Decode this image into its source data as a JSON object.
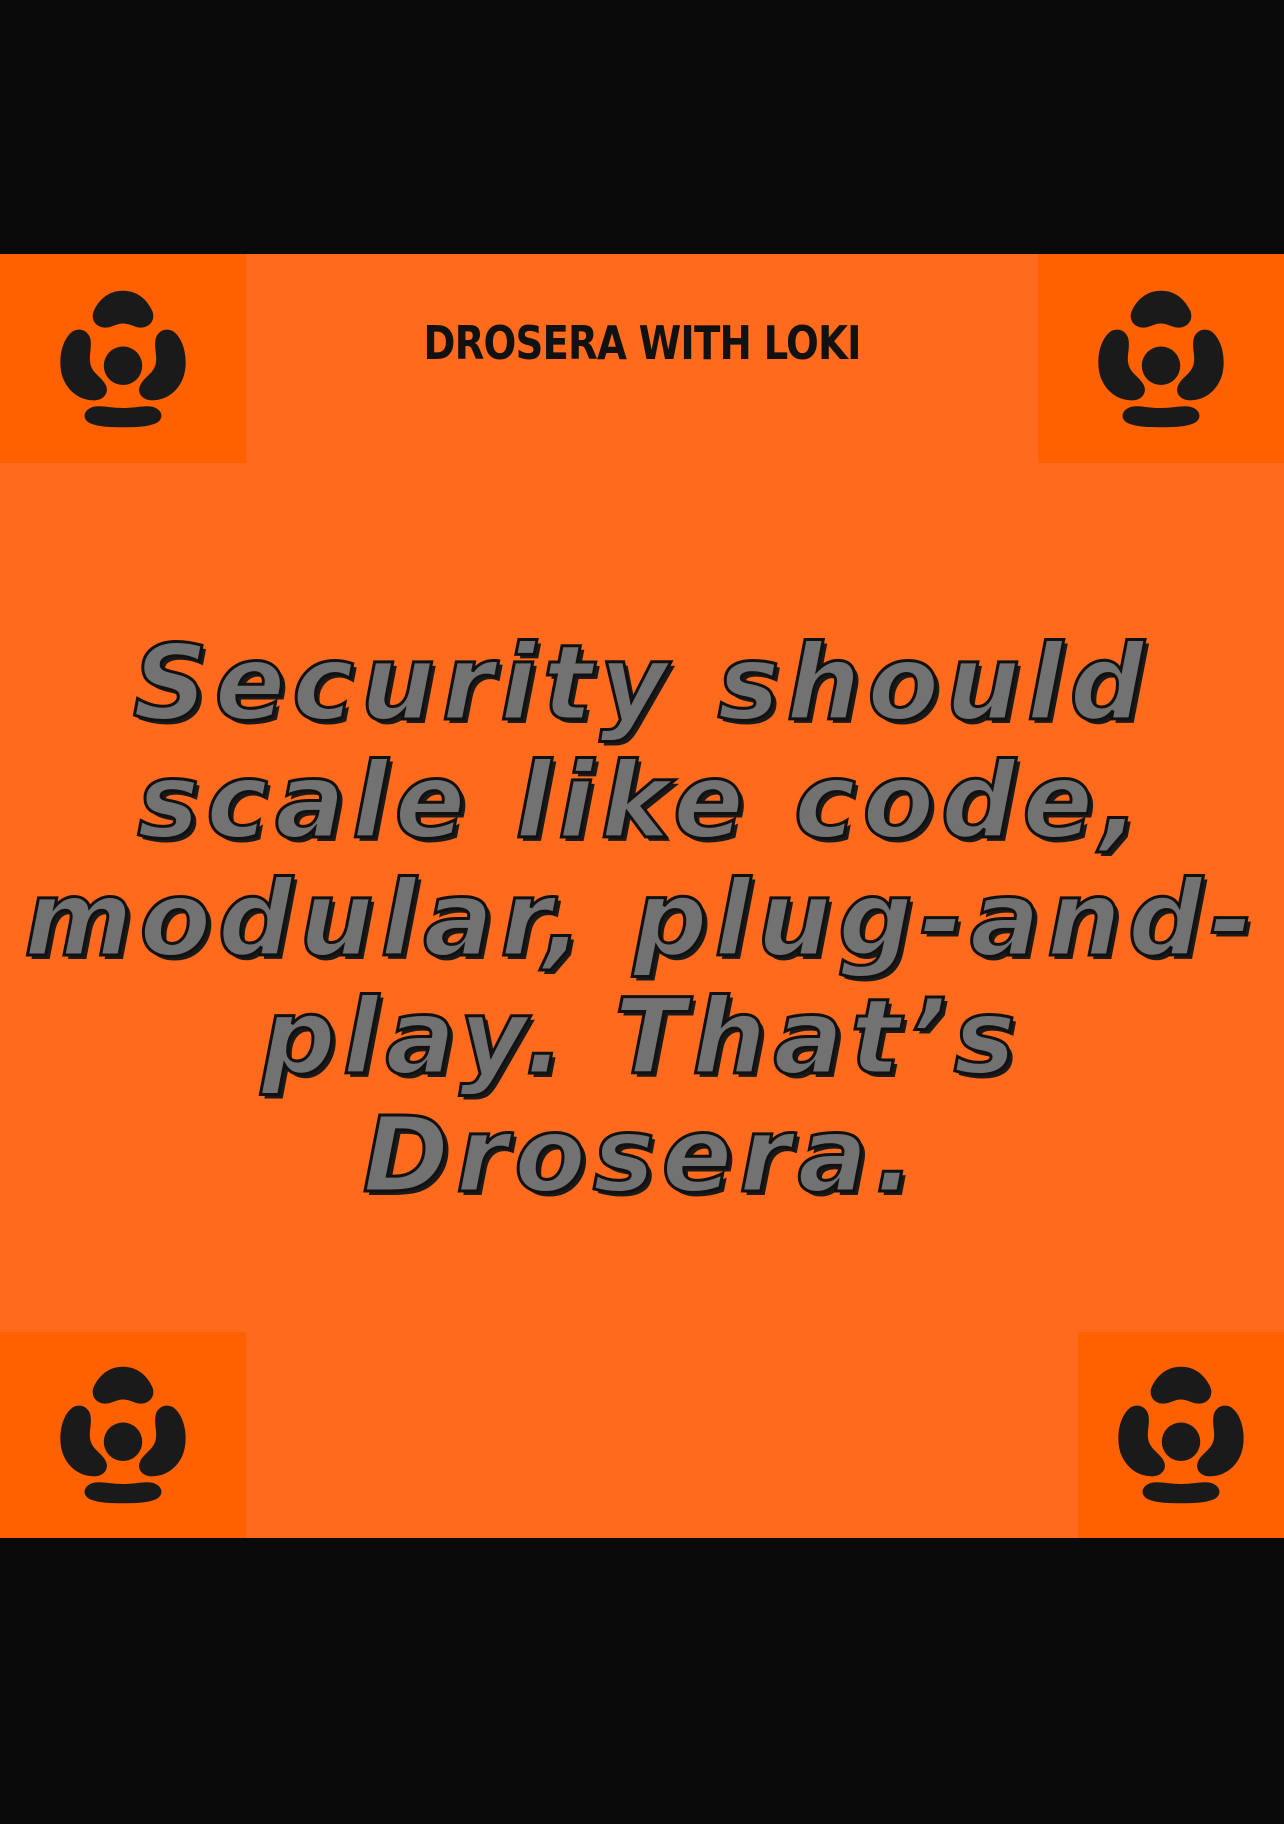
{
  "header": {
    "title": "DROSERA WITH LOKI"
  },
  "quote": {
    "lines": [
      "Security should",
      "scale like code,",
      "modular, plug-and-",
      "play. That’s",
      "Drosera."
    ]
  },
  "icons": {
    "corner": "drosera-logo-icon"
  },
  "colors": {
    "background": "#0a0a0a",
    "card": "#ff6a1c",
    "corner_tile": "#ff6000",
    "logo": "#1a1a1a",
    "quote_fill": "#727272",
    "quote_outline": "#111111"
  }
}
